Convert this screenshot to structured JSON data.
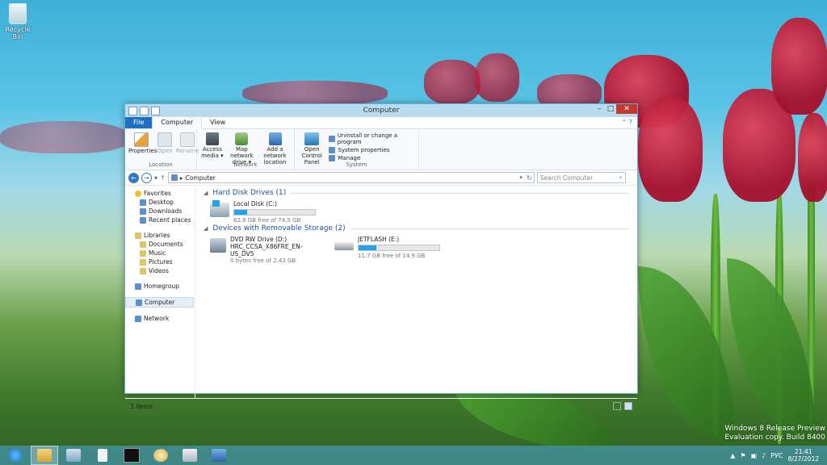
{
  "desktop": {
    "recycle_bin_label": "Recycle Bin"
  },
  "window": {
    "title": "Computer",
    "tabs": [
      "File",
      "Computer",
      "View"
    ],
    "ribbon": {
      "location_group": {
        "label": "Location",
        "properties": "Properties",
        "open": "Open",
        "rename": "Rename"
      },
      "network_group": {
        "label": "Network",
        "access_media": "Access media ▾",
        "map_network_drive": "Map network drive ▾",
        "add_network_location": "Add a network location"
      },
      "system_group": {
        "label": "System",
        "open_control_panel": "Open Control Panel",
        "uninstall": "Uninstall or change a program",
        "system_properties": "System properties",
        "manage": "Manage"
      }
    },
    "address": {
      "path": "Computer",
      "search_placeholder": "Search Computer"
    },
    "nav_pane": {
      "favorites": "Favorites",
      "desktop": "Desktop",
      "downloads": "Downloads",
      "recent_places": "Recent places",
      "libraries": "Libraries",
      "documents": "Documents",
      "music": "Music",
      "pictures": "Pictures",
      "videos": "Videos",
      "homegroup": "Homegroup",
      "computer": "Computer",
      "network": "Network"
    },
    "sections": {
      "hard_disk_drives": "Hard Disk Drives (1)",
      "removable": "Devices with Removable Storage (2)"
    },
    "drives": {
      "local_disk": {
        "name": "Local Disk (C:)",
        "free": "62.8 GB free of 74.5 GB",
        "used_fraction": 0.157
      },
      "dvd": {
        "name": "DVD RW Drive (D:)",
        "label": "HRC_CCSA_X86FRE_EN-US_DV5",
        "free": "0 bytes free of 2.43 GB"
      },
      "usb": {
        "name": "JETFLASH (E:)",
        "free": "11.7 GB free of 14.9 GB",
        "used_fraction": 0.215
      }
    },
    "status": {
      "items_count": "3 items"
    }
  },
  "taskbar": {
    "language": "РУС",
    "time": "21:41",
    "date": "8/27/2012"
  },
  "watermark": {
    "line1": "Windows 8 Release Preview",
    "line2": "Evaluation copy. Build 8400"
  },
  "colors": {
    "accent": "#2aa1e3",
    "file_tab": "#1f6fc3",
    "close": "#c7372f"
  }
}
